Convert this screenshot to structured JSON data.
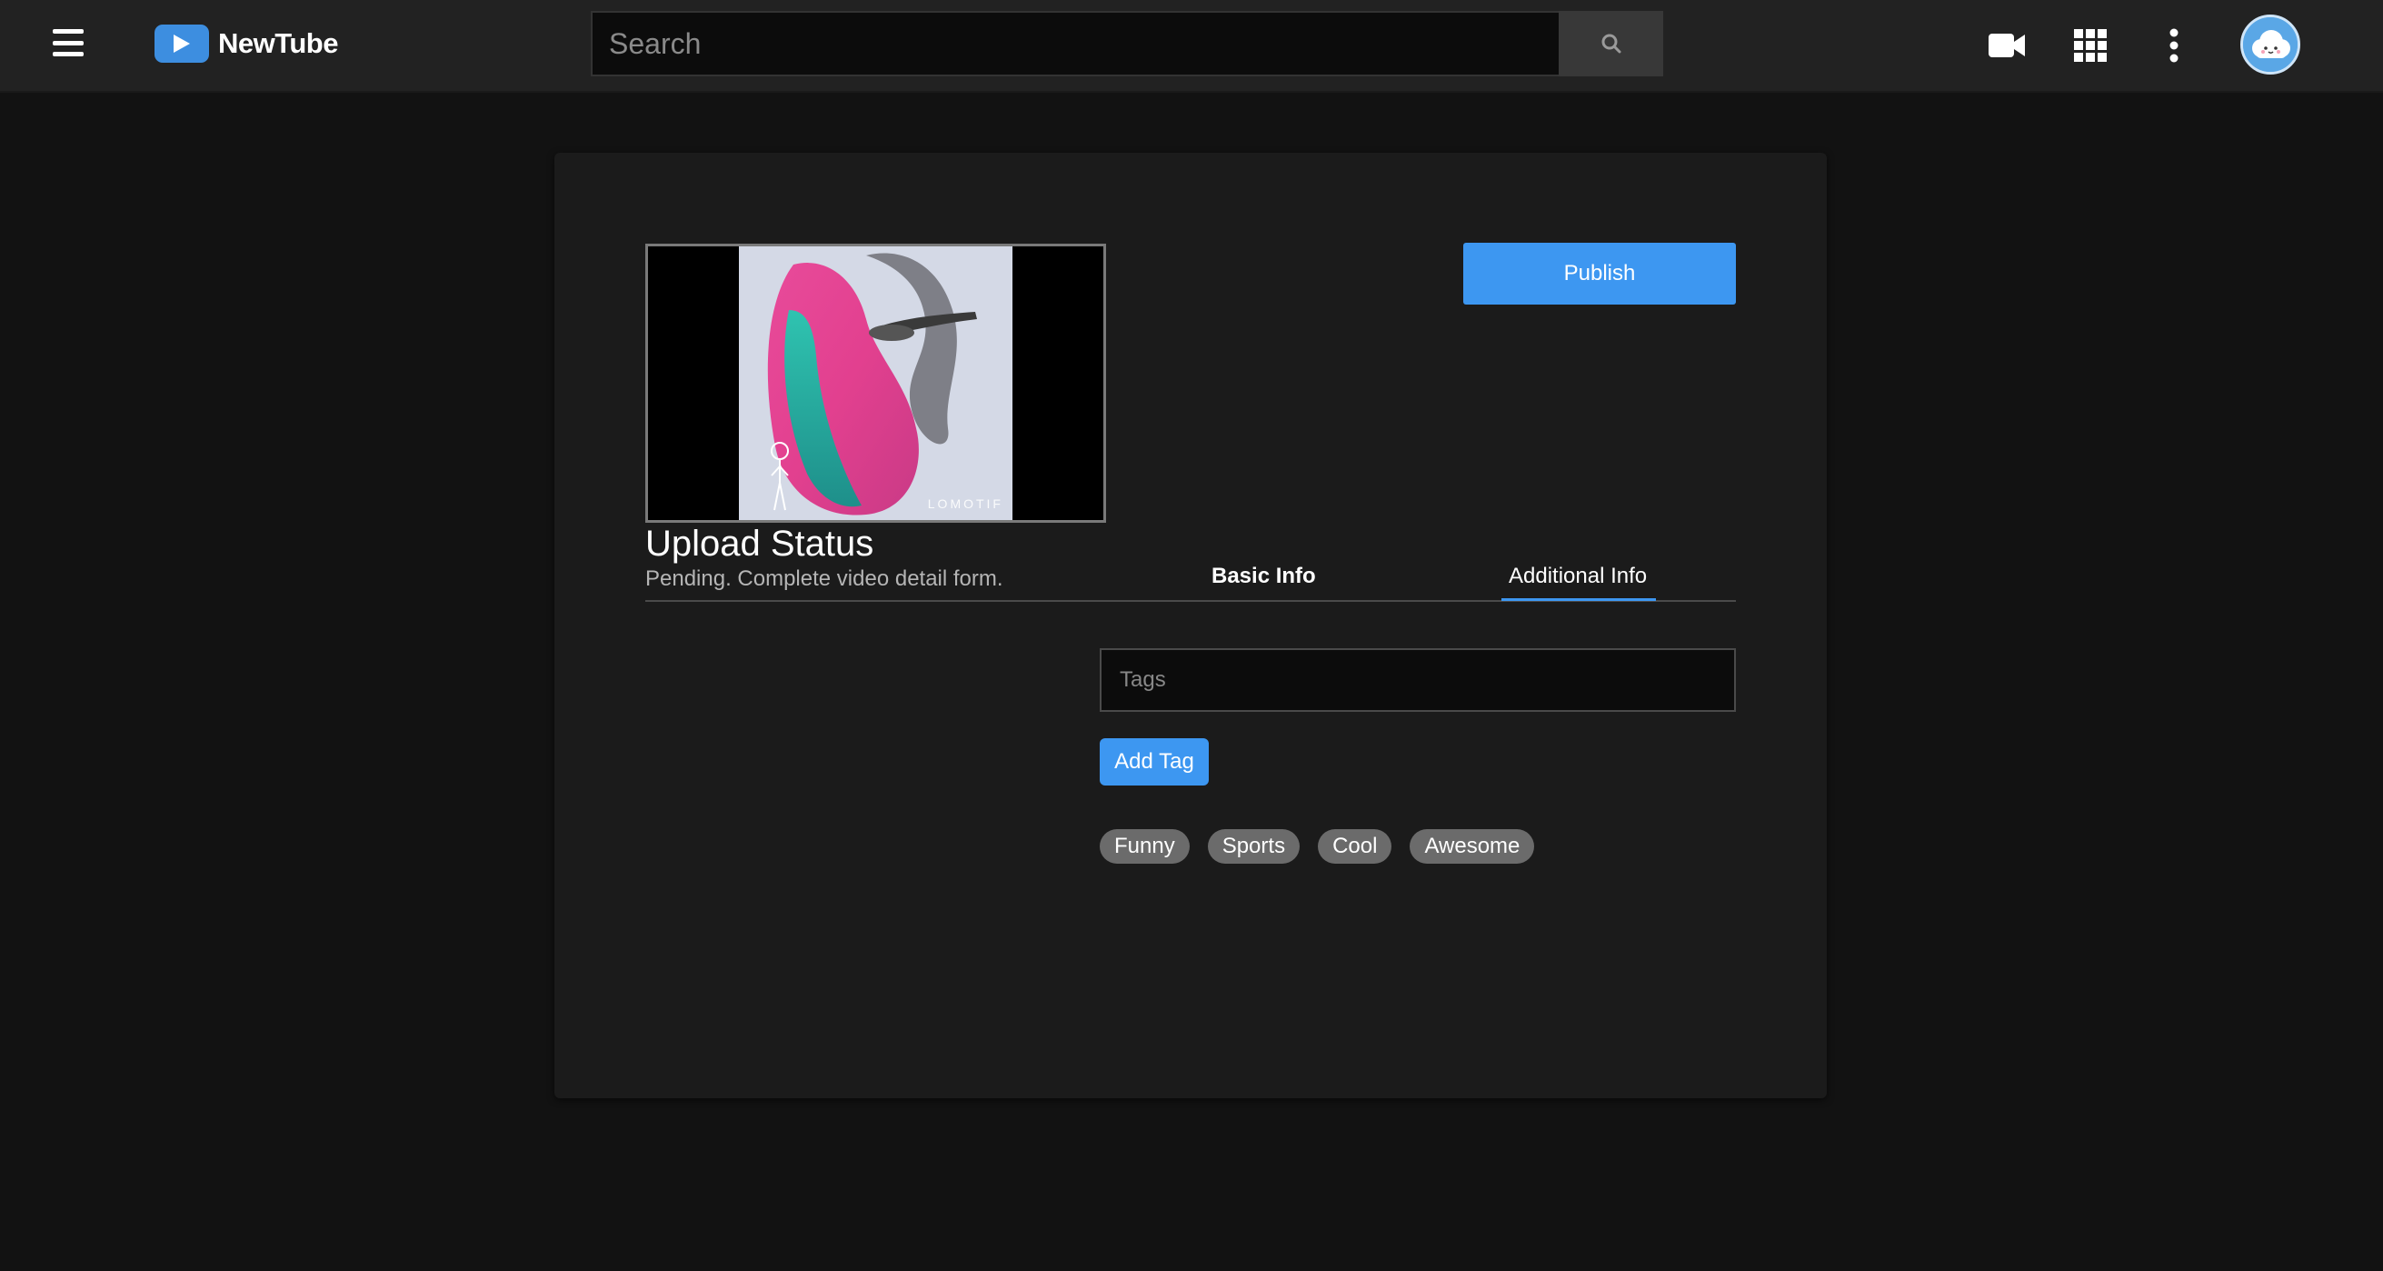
{
  "app": {
    "name": "NewTube",
    "brand_color": "#3d8ee0"
  },
  "header": {
    "menu_icon": "hamburger-menu-icon",
    "search": {
      "placeholder": "Search",
      "value": ""
    },
    "icons": [
      "video-camera-icon",
      "apps-grid-icon",
      "more-vertical-icon",
      "avatar-cloud-icon"
    ]
  },
  "preview": {
    "watermark": "LOMOTIF"
  },
  "actions": {
    "publish_label": "Publish"
  },
  "upload": {
    "title": "Upload Status",
    "status": "Pending. Complete video detail form."
  },
  "tabs": [
    {
      "label": "Basic Info",
      "active": false
    },
    {
      "label": "Additional Info",
      "active": true
    }
  ],
  "tags_form": {
    "placeholder": "Tags",
    "value": "",
    "add_label": "Add Tag",
    "tags": [
      "Funny",
      "Sports",
      "Cool",
      "Awesome"
    ]
  },
  "colors": {
    "accent": "#3d97f1",
    "background": "#121212",
    "card": "#1b1b1b",
    "topbar": "#222222",
    "chip": "#6b6b6b"
  }
}
